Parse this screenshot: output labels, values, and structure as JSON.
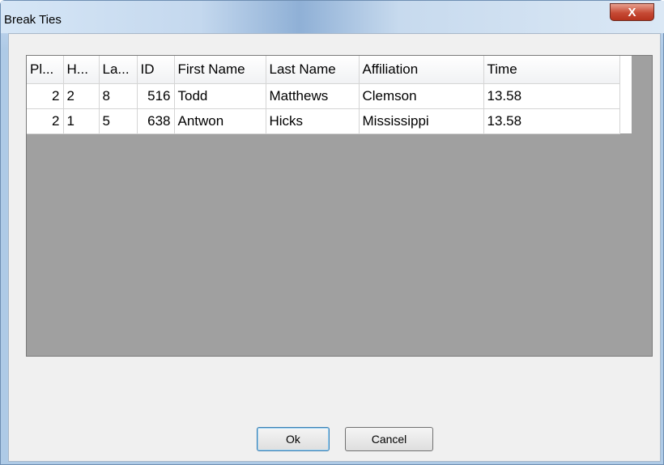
{
  "window": {
    "title": "Break Ties",
    "close_glyph": "X"
  },
  "table": {
    "columns": [
      "Pl...",
      "H...",
      "La...",
      "ID",
      "First Name",
      "Last Name",
      "Affiliation",
      "Time"
    ],
    "rows": [
      [
        "2",
        "2",
        "8",
        "516",
        "Todd",
        "Matthews",
        "Clemson",
        "13.58"
      ],
      [
        "2",
        "1",
        "5",
        "638",
        "Antwon",
        "Hicks",
        "Mississippi",
        "13.58"
      ]
    ]
  },
  "buttons": {
    "ok": "Ok",
    "cancel": "Cancel"
  }
}
